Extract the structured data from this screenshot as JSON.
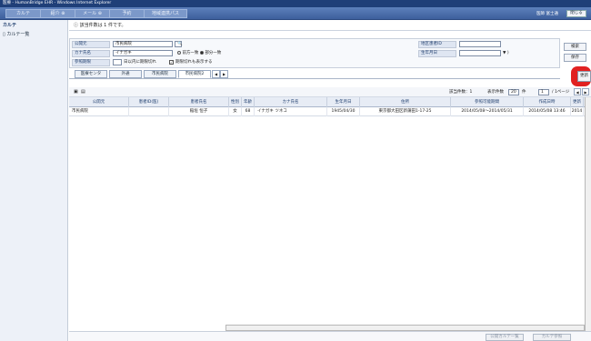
{
  "window_title": "医療 - HumanBridge EHR - Windows Internet Explorer",
  "nav": {
    "tabs": [
      "カルテ",
      "紹介 ⊕",
      "メール ⊕",
      "予約",
      "地域連携パス"
    ],
    "user": "医師 富士通",
    "logout": "閉じる"
  },
  "sidebar": {
    "title": "カルテ",
    "item": "カルテ一覧"
  },
  "message": "ⓘ 該当件数は 1 件です。",
  "form": {
    "label_hospital": "公開元",
    "hospital_value": "市民病院",
    "label_kana": "カナ氏名",
    "kana_value": "イナガキ",
    "radio_prefix": "前方一致",
    "radio_partial": "部分一致",
    "label_period": "参照期限",
    "period_text": "日以内に期限切れ",
    "expired_text": "期限切れも表示する",
    "label_patient_id": "地区患者ID",
    "patient_id_value": "",
    "label_birthday": "生年月日",
    "birthday_value": "",
    "birthday_suffix": "▼ )"
  },
  "side_buttons": {
    "search": "検索",
    "save": "保存",
    "other": "更新"
  },
  "filter_tabs": [
    "医療センタ",
    "外通",
    "市民病院",
    "市民病院2"
  ],
  "result_bar": {
    "count_label": "該当件数：1",
    "per_page_label": "表示件数",
    "per_page_value": "20",
    "per_page_suffix": "件",
    "page_value": "1",
    "page_suffix": "/ 1ページ"
  },
  "table": {
    "headers": [
      "公開元",
      "患者ID(医)",
      "患者氏名",
      "性別",
      "年齢",
      "カナ氏名",
      "生年月日",
      "住所",
      "参照可能期間",
      "作成日時",
      "更新"
    ],
    "rows": [
      [
        "市民病院",
        "",
        "稲垣 恒子",
        "女",
        "68",
        "イナガキ ツネコ",
        "1945/04/30",
        "東京都大田区新蒲田1-17-25",
        "2014/05/08～2014/05/31",
        "2014/05/08 13:46",
        "2014"
      ]
    ]
  },
  "footer": {
    "button1": "公開カルテ一覧",
    "button2": "カルテ参照"
  }
}
